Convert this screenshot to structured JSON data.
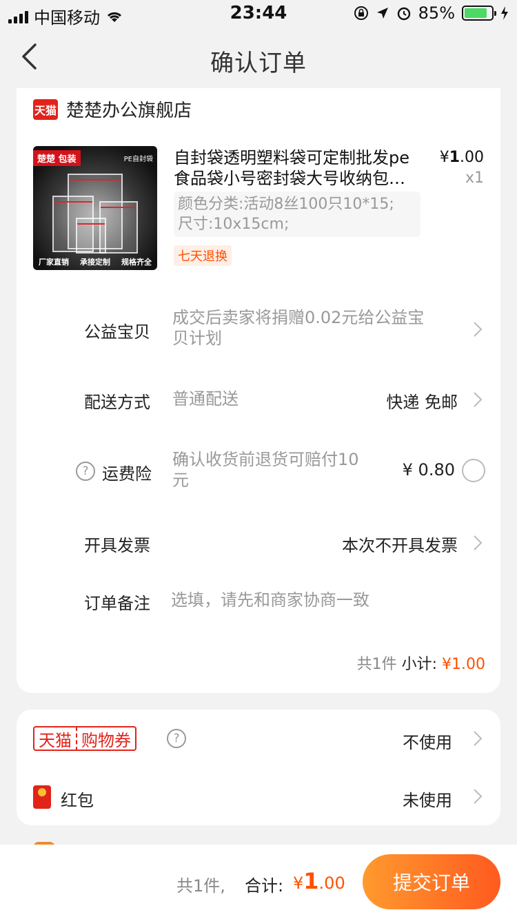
{
  "status_bar": {
    "carrier": "中国移动",
    "time": "23:44",
    "battery": "85%"
  },
  "nav": {
    "title": "确认订单"
  },
  "shop": {
    "badge": "天猫",
    "name": "楚楚办公旗舰店"
  },
  "product": {
    "img_tag": "楚楚 包装",
    "img_tag2": "PE自封袋",
    "img_footer": [
      "厂家直销",
      "承接定制",
      "规格齐全"
    ],
    "title_line1": "自封袋透明塑料袋可定制批发pe",
    "title_line2": "食品袋小号密封袋大号收纳包…",
    "price_symbol": "¥",
    "price_int": "1",
    "price_dec": ".00",
    "qty": "x1",
    "sku_line1": "颜色分类:活动8丝100只10*15;",
    "sku_line2": "尺寸:10x15cm;",
    "return_tag": "七天退换"
  },
  "rows": {
    "charity": {
      "label": "公益宝贝",
      "desc_line1": "成交后卖家将捐赠0.02元给公益宝",
      "desc_line2": "贝计划"
    },
    "shipping": {
      "label": "配送方式",
      "desc": "普通配送",
      "value": "快递 免邮"
    },
    "insurance": {
      "label": "运费险",
      "desc_line1": "确认收货前退货可赔付10",
      "desc_line2": "元",
      "value": "¥ 0.80"
    },
    "invoice": {
      "label": "开具发票",
      "value": "本次不开具发票"
    },
    "note": {
      "label": "订单备注",
      "placeholder": "选填，请先和商家协商一致"
    }
  },
  "subtotal": {
    "count": "共1件",
    "label": "小计:",
    "amount": "¥1.00"
  },
  "coupons": {
    "tmall_a": "天猫",
    "tmall_b": "购物券",
    "tmall_value": "不使用",
    "redpacket_label": "红包",
    "redpacket_value": "未使用"
  },
  "bottom": {
    "count": "共1件,",
    "total_label": "合计:",
    "total_symbol": "¥",
    "total_int": "1",
    "total_dec": ".00",
    "submit": "提交订单"
  }
}
